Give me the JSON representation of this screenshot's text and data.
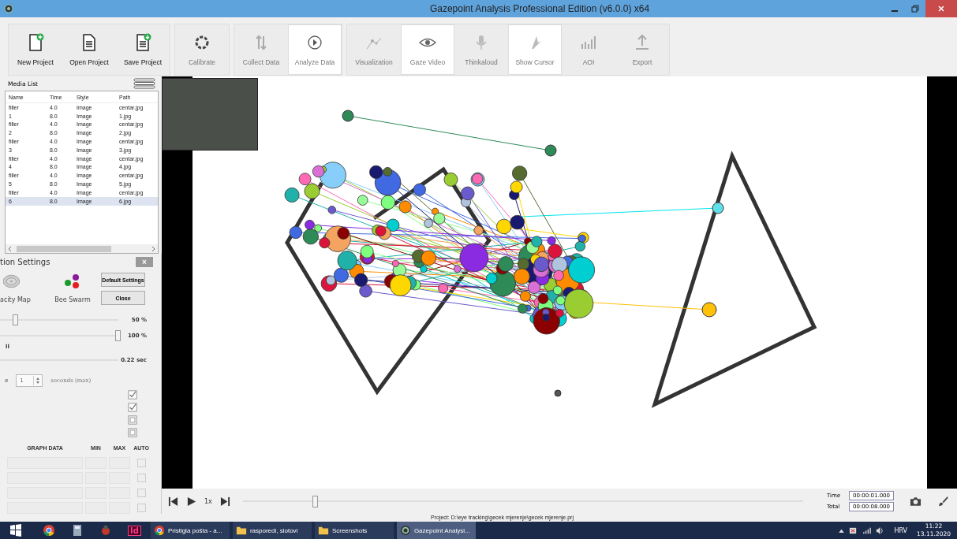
{
  "window": {
    "title": "Gazepoint Analysis Professional Edition (v6.0.0) x64"
  },
  "toolbar": {
    "groups": [
      [
        {
          "label": "New Project",
          "kind": "new",
          "disabled": false,
          "selected": false
        },
        {
          "label": "Open Project",
          "kind": "open",
          "disabled": false,
          "selected": false
        },
        {
          "label": "Save Project",
          "kind": "save",
          "disabled": false,
          "selected": false
        }
      ],
      [
        {
          "label": "Calibrate",
          "kind": "calibrate",
          "disabled": true,
          "selected": false
        }
      ],
      [
        {
          "label": "Collect Data",
          "kind": "collect",
          "disabled": true,
          "selected": false
        },
        {
          "label": "Analyze Data",
          "kind": "analyze",
          "disabled": false,
          "selected": true
        }
      ],
      [
        {
          "label": "Visualization",
          "kind": "visualization",
          "disabled": true,
          "selected": false
        },
        {
          "label": "Gaze Video",
          "kind": "eye",
          "disabled": false,
          "selected": true
        },
        {
          "label": "Thinkaloud",
          "kind": "mic",
          "disabled": true,
          "selected": false
        },
        {
          "label": "Show Cursor",
          "kind": "cursor",
          "disabled": false,
          "selected": true
        },
        {
          "label": "AOI",
          "kind": "aoi",
          "disabled": true,
          "selected": false
        },
        {
          "label": "Export",
          "kind": "export",
          "disabled": true,
          "selected": false
        }
      ]
    ]
  },
  "media_list": {
    "title": "Media List",
    "columns": [
      "Name",
      "Time",
      "Style",
      "Path"
    ],
    "rows": [
      {
        "cells": [
          "filler",
          "4.0",
          "Image",
          "centar.jpg"
        ],
        "selected": false
      },
      {
        "cells": [
          "1",
          "8.0",
          "Image",
          "1.jpg"
        ],
        "selected": false
      },
      {
        "cells": [
          "filler",
          "4.0",
          "Image",
          "centar.jpg"
        ],
        "selected": false
      },
      {
        "cells": [
          "2",
          "8.0",
          "Image",
          "2.jpg"
        ],
        "selected": false
      },
      {
        "cells": [
          "filler",
          "4.0",
          "Image",
          "centar.jpg"
        ],
        "selected": false
      },
      {
        "cells": [
          "3",
          "8.0",
          "Image",
          "3.jpg"
        ],
        "selected": false
      },
      {
        "cells": [
          "filler",
          "4.0",
          "Image",
          "centar.jpg"
        ],
        "selected": false
      },
      {
        "cells": [
          "4",
          "8.0",
          "Image",
          "4.jpg"
        ],
        "selected": false
      },
      {
        "cells": [
          "filler",
          "4.0",
          "Image",
          "centar.jpg"
        ],
        "selected": false
      },
      {
        "cells": [
          "5",
          "8.0",
          "Image",
          "5.jpg"
        ],
        "selected": false
      },
      {
        "cells": [
          "filler",
          "4.0",
          "Image",
          "centar.jpg"
        ],
        "selected": false
      },
      {
        "cells": [
          "6",
          "8.0",
          "Image",
          "6.jpg"
        ],
        "selected": true
      }
    ]
  },
  "settings": {
    "title": "tion Settings",
    "close": "×",
    "modes": [
      {
        "label": "acity Map",
        "kind": "opacity"
      },
      {
        "label": "Bee Swarm",
        "kind": "swarm"
      }
    ],
    "buttons": [
      "Default Settings",
      "Close"
    ],
    "sliders": [
      {
        "level": 0.5,
        "reading": "50 %"
      },
      {
        "level": 1,
        "reading": "100 %"
      }
    ],
    "section_label": "ll",
    "duration": {
      "reading": "0.22 sec"
    },
    "spin": {
      "label": "e",
      "value": "1",
      "unit": "seconds (max)"
    },
    "options": [
      {
        "checked": true
      },
      {
        "checked": true
      },
      {
        "checked": false
      },
      {
        "checked": false
      }
    ],
    "graph": {
      "columns": [
        "GRAPH DATA",
        "MIN",
        "MAX",
        "AUTO"
      ],
      "rows": [
        {
          "checked": false
        },
        {
          "checked": false
        },
        {
          "checked": false
        },
        {
          "checked": false
        }
      ]
    }
  },
  "playback": {
    "speed": "1x",
    "level": 0.13,
    "time_label": "Time",
    "time": "00:00:01.000",
    "total_label": "Total",
    "total": "00:00:08.000"
  },
  "status": "Project: D:\\eye tracking\\gecek mjerenje\\gecek mjerenje.prj",
  "taskbar": {
    "pinned_label": "Id",
    "tasks": [
      {
        "label": "Pristigla pošta - a...",
        "kind": "chrome",
        "selected": false
      },
      {
        "label": "rasporedi, slotovi",
        "kind": "folder",
        "selected": false
      },
      {
        "label": "Screenshots",
        "kind": "folder",
        "selected": false
      },
      {
        "label": "Gazepoint Analysi...",
        "kind": "gaze",
        "selected": true
      }
    ],
    "language": "HRV",
    "time": "11:22",
    "date": "13.11.2020"
  }
}
